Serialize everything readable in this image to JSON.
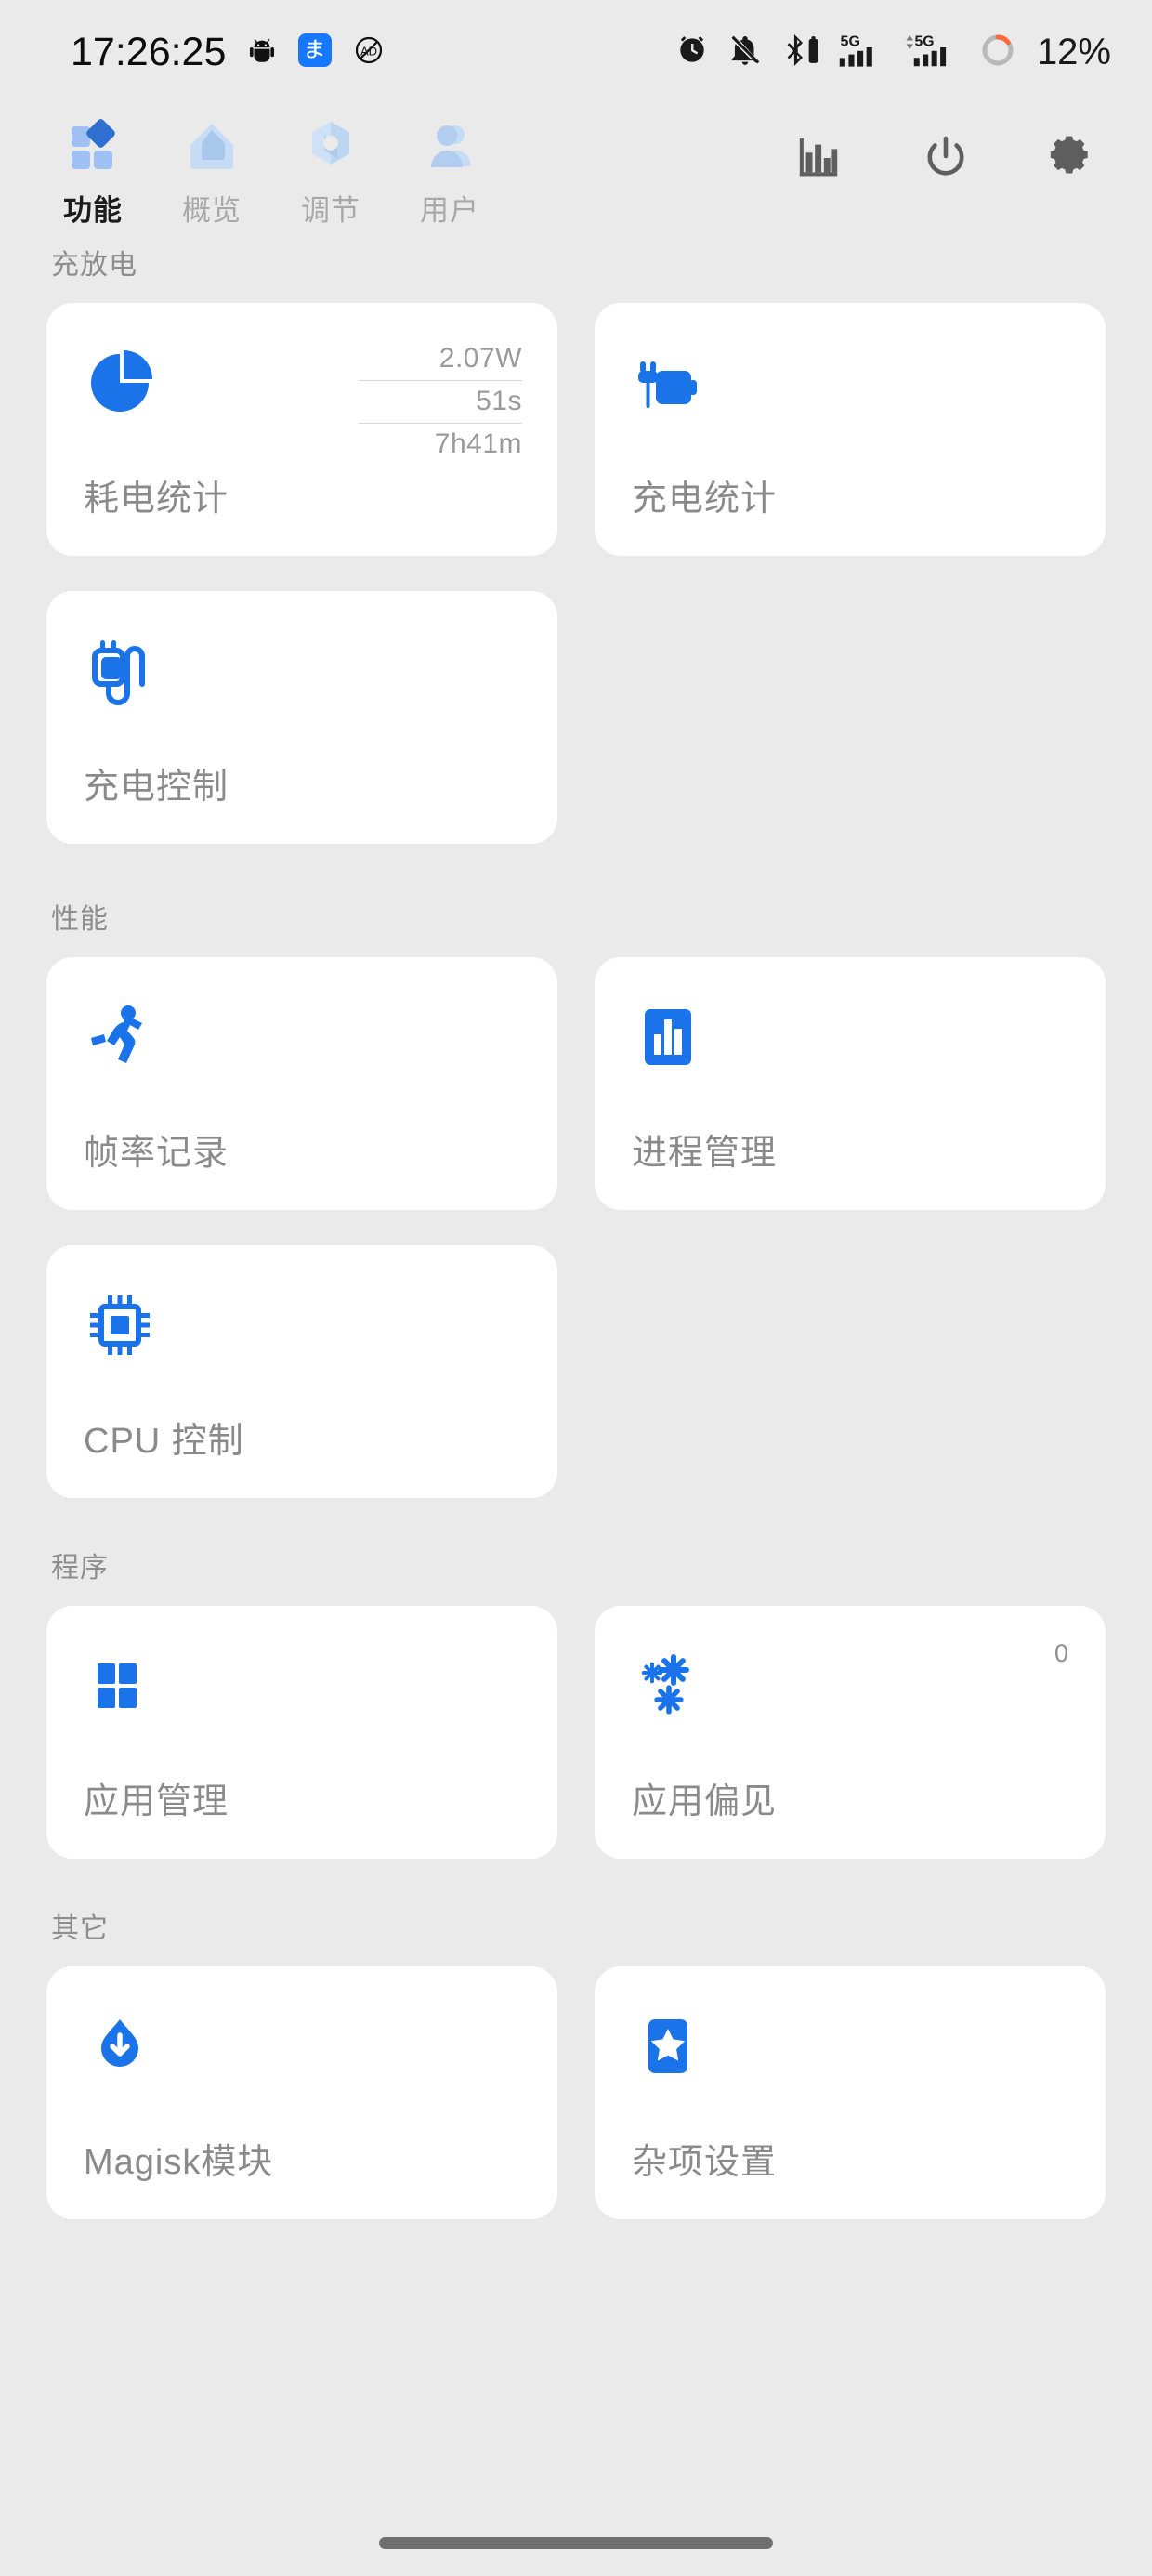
{
  "status_bar": {
    "time": "17:26:25",
    "battery_percent": "12%",
    "left_icons": [
      "android-bug-icon",
      "alipay-icon",
      "ad-block-icon"
    ],
    "right_icons": [
      "alarm-icon",
      "notifications-off-icon",
      "bluetooth-battery-icon",
      "signal-5g-icon",
      "signal-5g-data-icon",
      "battery-ring-icon"
    ],
    "battery_ring_color": "#ff6a3d"
  },
  "nav": {
    "tabs": [
      {
        "label": "功能",
        "icon": "blocks-diamond-icon",
        "active": true
      },
      {
        "label": "概览",
        "icon": "home-icon",
        "active": false
      },
      {
        "label": "调节",
        "icon": "hexagon-gear-icon",
        "active": false
      },
      {
        "label": "用户",
        "icon": "user-icon",
        "active": false
      }
    ],
    "tools": [
      {
        "name": "chart-icon"
      },
      {
        "name": "power-icon"
      },
      {
        "name": "gear-icon"
      }
    ]
  },
  "theme": {
    "accent": "#1a73e8",
    "background": "#eaeaea",
    "card": "#ffffff",
    "label_color": "#8a8a8a",
    "section_color": "#8d8d8d"
  },
  "sections": [
    {
      "title": "充放电",
      "cards": [
        {
          "label": "耗电统计",
          "icon": "pie-chart-icon",
          "stats": [
            "2.07W",
            "51s",
            "7h41m"
          ]
        },
        {
          "label": "充电统计",
          "icon": "battery-charging-icon"
        },
        {
          "label": "充电控制",
          "icon": "power-plug-cable-icon"
        }
      ]
    },
    {
      "title": "性能",
      "cards": [
        {
          "label": "帧率记录",
          "icon": "running-person-icon"
        },
        {
          "label": "进程管理",
          "icon": "bar-chart-square-icon"
        },
        {
          "label": "CPU 控制",
          "icon": "cpu-chip-icon"
        }
      ]
    },
    {
      "title": "程序",
      "cards": [
        {
          "label": "应用管理",
          "icon": "grid-squares-icon"
        },
        {
          "label": "应用偏见",
          "icon": "snowflakes-icon",
          "badge": "0"
        }
      ]
    },
    {
      "title": "其它",
      "cards": [
        {
          "label": "Magisk模块",
          "icon": "magisk-download-icon"
        },
        {
          "label": "杂项设置",
          "icon": "star-bookmark-icon"
        }
      ]
    }
  ]
}
